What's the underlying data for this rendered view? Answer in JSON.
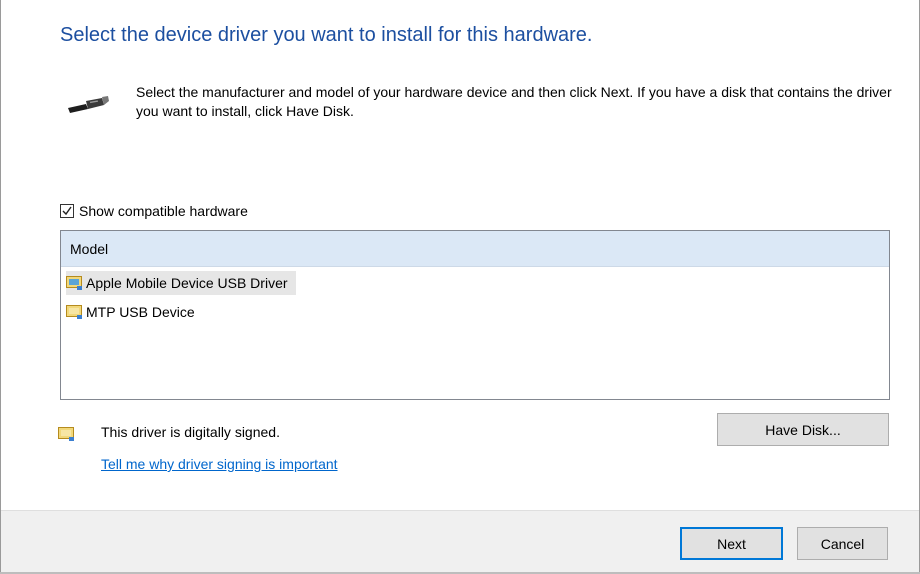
{
  "header": {
    "title": "Select the device driver you want to install for this hardware.",
    "description": "Select the manufacturer and model of your hardware device and then click Next. If you have a disk that contains the driver you want to install, click Have Disk."
  },
  "compat": {
    "label": "Show compatible hardware",
    "checked": true
  },
  "model_list": {
    "header": "Model",
    "items": [
      {
        "label": "Apple Mobile Device USB Driver",
        "selected": true,
        "icon": "driver-icon"
      },
      {
        "label": "MTP USB Device",
        "selected": false,
        "icon": "driver-icon"
      }
    ]
  },
  "signing": {
    "status": "This driver is digitally signed.",
    "link": "Tell me why driver signing is important"
  },
  "buttons": {
    "have_disk": "Have Disk...",
    "next": "Next",
    "cancel": "Cancel"
  },
  "colors": {
    "title": "#1c4fa0",
    "link": "#0066cc",
    "list_header": "#dbe8f6",
    "selected_row": "#e6e6e6",
    "accent": "#0078d7"
  }
}
